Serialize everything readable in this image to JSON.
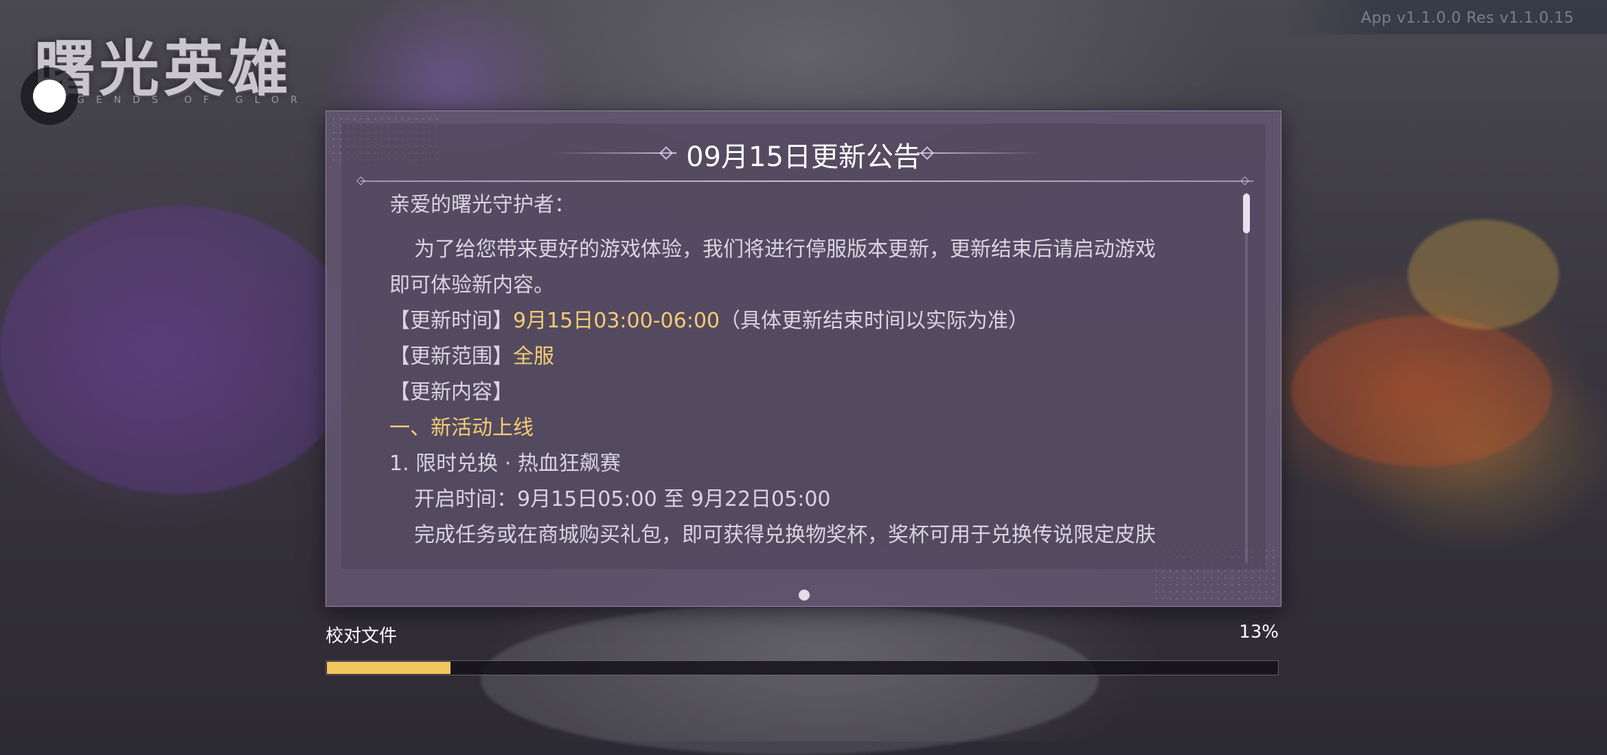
{
  "version_text": "App v1.1.0.0  Res v1.1.0.15",
  "logo": {
    "title": "曙光英雄",
    "subtitle": "GENDS OF GLOR"
  },
  "notice": {
    "title": "09月15日更新公告",
    "greeting": "亲爱的曙光守护者：",
    "intro_line1": "为了给您带来更好的游戏体验，我们将进行停服版本更新，更新结束后请启动游戏",
    "intro_line2": "即可体验新内容。",
    "time_label": "【更新时间】",
    "time_value": "9月15日03:00-06:00",
    "time_note": "（具体更新结束时间以实际为准）",
    "scope_label": "【更新范围】",
    "scope_value": "全服",
    "content_label": "【更新内容】",
    "section1_title": "一、新活动上线",
    "item1_title": "1. 限时兑换 · 热血狂飙赛",
    "item1_time": "开启时间：9月15日05:00 至 9月22日05:00",
    "item1_desc": "完成任务或在商城购买礼包，即可获得兑换物奖杯，奖杯可用于兑换传说限定皮肤"
  },
  "progress": {
    "label": "校对文件",
    "percent_text": "13%",
    "value": 0.13
  },
  "colors": {
    "accent_gold": "#f3cd74",
    "progress_fill": "#f2c75e",
    "panel_bg": "#625670"
  },
  "icons": {
    "float_button": "assistive-touch-dot",
    "page_indicator": "page-dot"
  }
}
